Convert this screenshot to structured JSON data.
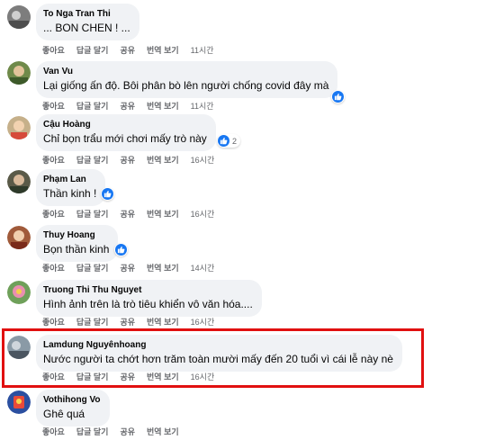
{
  "actions": {
    "like": "좋아요",
    "reply": "답글 달기",
    "share": "공유",
    "translate": "번역 보기"
  },
  "colors": {
    "bubble": "#f0f2f5",
    "like_blue": "#1877f2",
    "highlight_border": "#e11010"
  },
  "comments": [
    {
      "author": "To Nga Tran Thi",
      "text": "... BON CHEN ! ...",
      "time": "11시간",
      "likes": ""
    },
    {
      "author": "Van Vu",
      "text": "Lại giống ấn độ. Bôi phân bò lên người chống covid đây mà",
      "time": "11시간",
      "likes": ""
    },
    {
      "author": "Cậu Hoàng",
      "text": "Chỉ bọn trẩu mới chơi mấy trò này",
      "time": "16시간",
      "likes": "2"
    },
    {
      "author": "Phạm Lan",
      "text": "Thần kinh !",
      "time": "16시간",
      "likes": ""
    },
    {
      "author": "Thuy Hoang",
      "text": "Bọn thần kinh",
      "time": "14시간",
      "likes": ""
    },
    {
      "author": "Truong Thi Thu Nguyet",
      "text": "Hình ảnh trên là trò tiêu khiển vô văn hóa....",
      "time": "16시간",
      "likes": ""
    },
    {
      "author": "Lamdung Nguyênhoang",
      "text": "Nước người ta chớt hơn trăm toàn mười mấy đến 20 tuổi vì cái lễ này nè",
      "time": "16시간",
      "likes": ""
    },
    {
      "author": "Vothihong Vo",
      "text": "Ghê quá",
      "time": "",
      "likes": ""
    }
  ]
}
